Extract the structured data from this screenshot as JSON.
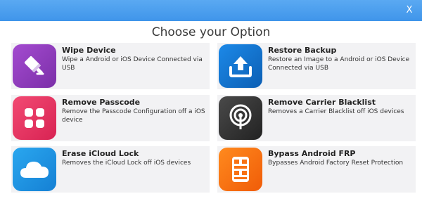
{
  "window": {
    "close_label": "X"
  },
  "heading": "Choose your Option",
  "options": [
    {
      "title": "Wipe Device",
      "description": "Wipe a Android or iOS Device Connected via USB",
      "icon": "eraser-icon",
      "color": "#8e3cbf"
    },
    {
      "title": "Restore Backup",
      "description": "Restore an Image to a  Android or iOS Device Connected via USB",
      "icon": "upload-icon",
      "color": "#1675d0"
    },
    {
      "title": "Remove Passcode",
      "description": "Remove the Passcode Configuration off a iOS device",
      "icon": "keypad-icon",
      "color": "#e83563"
    },
    {
      "title": "Remove Carrier Blacklist",
      "description": "Removes a Carrier Blacklist off iOS devices",
      "icon": "signal-icon",
      "color": "#333333"
    },
    {
      "title": "Erase iCloud Lock",
      "description": "Removes the iCloud Lock off iOS devices",
      "icon": "cloud-icon",
      "color": "#1e95e2"
    },
    {
      "title": "Bypass Android FRP",
      "description": "Bypasses Android Factory Reset Protection",
      "icon": "chip-icon",
      "color": "#f87214"
    }
  ]
}
